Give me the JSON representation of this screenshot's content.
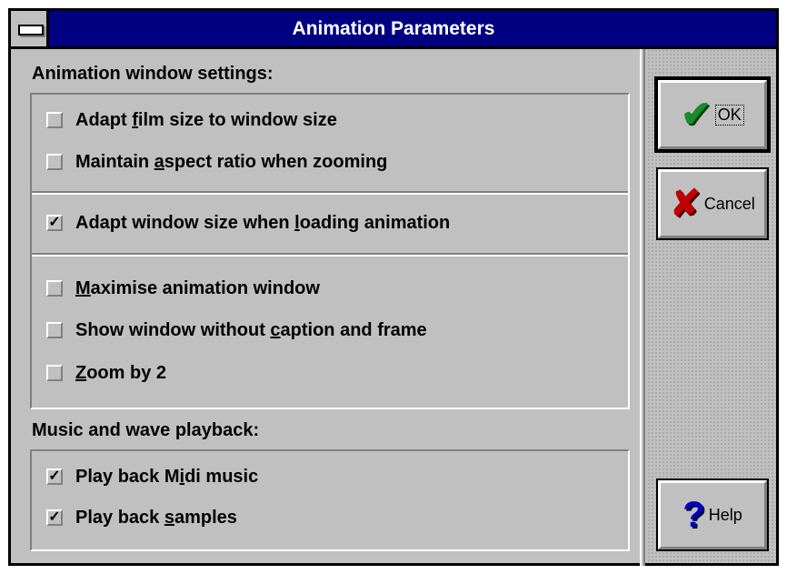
{
  "window": {
    "title": "Animation Parameters"
  },
  "animation_settings": {
    "header": "Animation window settings:",
    "group1": [
      {
        "pre": "Adapt ",
        "ul": "f",
        "post": "ilm size to window size",
        "checked": false,
        "mark": ""
      },
      {
        "pre": "Maintain ",
        "ul": "a",
        "post": "spect ratio when zooming",
        "checked": false,
        "mark": ""
      }
    ],
    "group2": [
      {
        "pre": "Adapt window size when ",
        "ul": "l",
        "post": "oading animation",
        "checked": true,
        "mark": "✓"
      }
    ],
    "group3": [
      {
        "pre": "",
        "ul": "M",
        "post": "aximise animation window",
        "checked": false,
        "mark": ""
      },
      {
        "pre": "Show window without ",
        "ul": "c",
        "post": "aption and frame",
        "checked": false,
        "mark": ""
      },
      {
        "pre": "",
        "ul": "Z",
        "post": "oom by 2",
        "checked": false,
        "mark": ""
      }
    ]
  },
  "music": {
    "header": "Music and wave playback:",
    "items": [
      {
        "pre": "Play back M",
        "ul": "i",
        "post": "di music",
        "checked": true,
        "mark": "✓"
      },
      {
        "pre": "Play back ",
        "ul": "s",
        "post": "amples",
        "checked": true,
        "mark": "✓"
      }
    ]
  },
  "buttons": {
    "ok": {
      "label": "OK",
      "icon": "checkmark-icon",
      "glyph": "✔",
      "color": "#1a8a2a"
    },
    "cancel": {
      "label": "Cancel",
      "icon": "x-cross-icon",
      "glyph": "✘",
      "color": "#c00000"
    },
    "help": {
      "label": "Help",
      "icon": "question-mark-icon",
      "glyph": "?",
      "color": "#0000c0"
    }
  },
  "colors": {
    "titlebar": "#000080",
    "face": "#c0c0c0"
  }
}
